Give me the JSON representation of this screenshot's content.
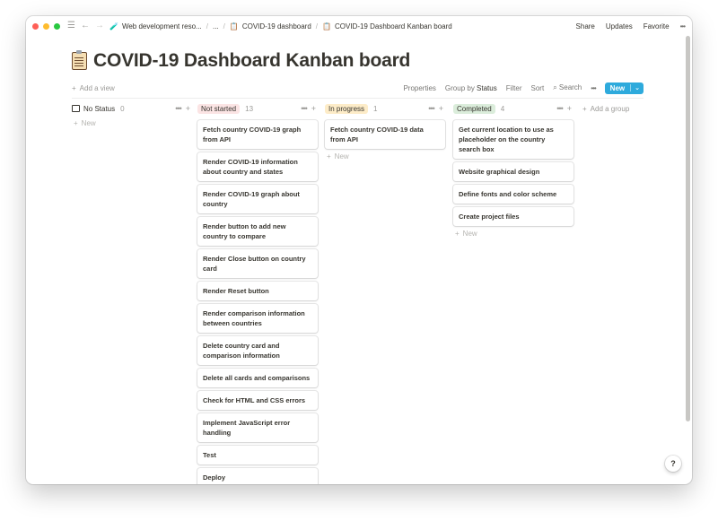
{
  "topbar": {
    "breadcrumb": [
      {
        "label": "Web development reso...",
        "icon": "flask-icon"
      },
      {
        "label": "..."
      },
      {
        "label": "COVID-19 dashboard",
        "icon": "page-icon"
      },
      {
        "label": "COVID-19 Dashboard Kanban board",
        "icon": "page-icon"
      }
    ],
    "actions": [
      "Share",
      "Updates",
      "Favorite",
      "•••"
    ]
  },
  "page": {
    "title": "COVID-19 Dashboard Kanban board",
    "icon": "clipboard-icon"
  },
  "viewbar": {
    "add_view": "Add a view",
    "properties": "Properties",
    "group_by_prefix": "Group by",
    "group_by_value": "Status",
    "filter": "Filter",
    "sort": "Sort",
    "search": "Search",
    "more": "•••",
    "new": "New"
  },
  "columns": [
    {
      "name": "No Status",
      "count": "0",
      "color": "",
      "new_label": "New",
      "cards": []
    },
    {
      "name": "Not started",
      "count": "13",
      "color": "#fbe4e4",
      "new_label": "",
      "cards": [
        "Fetch country COVID-19 graph from API",
        "Render COVID-19 information about country and states",
        "Render COVID-19 graph about country",
        "Render button to add new country to compare",
        "Render Close button on country card",
        "Render Reset button",
        "Render comparison information between countries",
        "Delete country card and comparison information",
        "Delete all cards and comparisons",
        "Check for HTML and CSS errors",
        "Implement JavaScript error handling",
        "Test",
        "Deploy"
      ]
    },
    {
      "name": "In progress",
      "count": "1",
      "color": "#fdecc8",
      "new_label": "New",
      "cards": [
        "Fetch country COVID-19 data from API"
      ]
    },
    {
      "name": "Completed",
      "count": "4",
      "color": "#dbeddb",
      "new_label": "New",
      "cards": [
        "Get current location to use as placeholder on the country search box",
        "Website graphical design",
        "Define fonts and color scheme",
        "Create project files"
      ]
    }
  ],
  "add_group": "Add a group",
  "help": "?"
}
